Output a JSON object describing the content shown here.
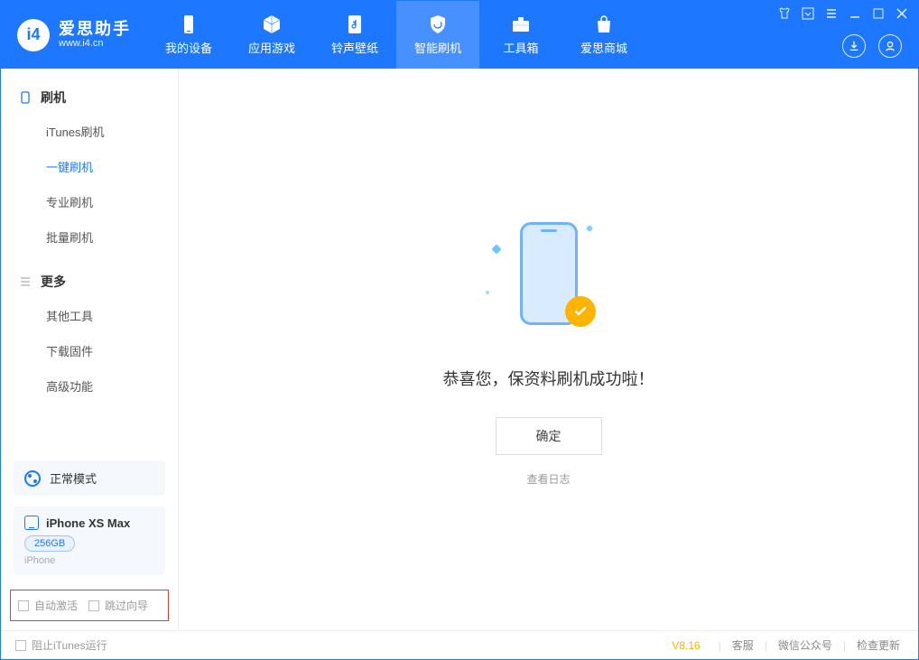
{
  "app": {
    "title": "爱思助手",
    "subtitle": "www.i4.cn",
    "version": "V8.16"
  },
  "nav": {
    "tabs": [
      {
        "label": "我的设备",
        "active": false
      },
      {
        "label": "应用游戏",
        "active": false
      },
      {
        "label": "铃声壁纸",
        "active": false
      },
      {
        "label": "智能刷机",
        "active": true
      },
      {
        "label": "工具箱",
        "active": false
      },
      {
        "label": "爱思商城",
        "active": false
      }
    ]
  },
  "sidebar": {
    "groups": [
      {
        "title": "刷机",
        "items": [
          "iTunes刷机",
          "一键刷机",
          "专业刷机",
          "批量刷机"
        ],
        "active_index": 1
      },
      {
        "title": "更多",
        "items": [
          "其他工具",
          "下载固件",
          "高级功能"
        ],
        "active_index": -1
      }
    ],
    "mode": "正常模式",
    "device": {
      "name": "iPhone XS Max",
      "capacity": "256GB",
      "type": "iPhone"
    },
    "highlight_options": {
      "auto_activate": "自动激活",
      "skip_guide": "跳过向导"
    }
  },
  "main": {
    "message": "恭喜您，保资料刷机成功啦！",
    "ok_label": "确定",
    "log_link": "查看日志"
  },
  "footer": {
    "block_itunes": "阻止iTunes运行",
    "links": [
      "客服",
      "微信公众号",
      "检查更新"
    ]
  }
}
